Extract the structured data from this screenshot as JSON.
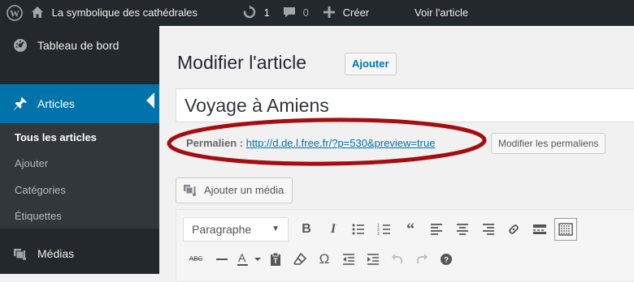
{
  "admin_bar": {
    "site_name": "La symbolique des cathédrales",
    "updates_count": "1",
    "comments_count": "0",
    "new_label": "Créer",
    "view_post_label": "Voir l'article",
    "wp_logo_icon": "wordpress-logo-icon",
    "home_icon": "home-icon",
    "updates_icon": "updates-icon",
    "comments_icon": "comment-bubble-icon",
    "new_icon": "plus-icon"
  },
  "sidebar": {
    "dashboard_label": "Tableau de bord",
    "posts_label": "Articles",
    "submenu": [
      {
        "label": "Tous les articles",
        "current": true
      },
      {
        "label": "Ajouter",
        "current": false
      },
      {
        "label": "Catégories",
        "current": false
      },
      {
        "label": "Étiquettes",
        "current": false
      }
    ],
    "media_label": "Médias",
    "accent_color": "#0073aa"
  },
  "main": {
    "page_title": "Modifier l'article",
    "add_new_label": "Ajouter",
    "post_title_value": "Voyage à Amiens",
    "permalink_label": "Permalien :",
    "permalink_url": "http://d.de.l.free.fr/?p=530&preview=true",
    "edit_permalinks_label": "Modifier les permaliens",
    "highlight_color": "#a50d10",
    "add_media_label": "Ajouter un média",
    "format_select_value": "Paragraphe"
  },
  "toolbar_row1_icons": [
    "bold-icon",
    "italic-icon",
    "bullet-list-icon",
    "numbered-list-icon",
    "blockquote-icon",
    "align-left-icon",
    "align-center-icon",
    "align-right-icon",
    "link-icon",
    "read-more-icon",
    "toolbar-toggle-icon"
  ],
  "toolbar_row2_icons": [
    "strikethrough-icon",
    "horizontal-rule-icon",
    "text-color-icon",
    "paste-as-text-icon",
    "clear-formatting-icon",
    "special-character-icon",
    "outdent-icon",
    "indent-icon",
    "undo-icon",
    "redo-icon",
    "help-icon"
  ]
}
